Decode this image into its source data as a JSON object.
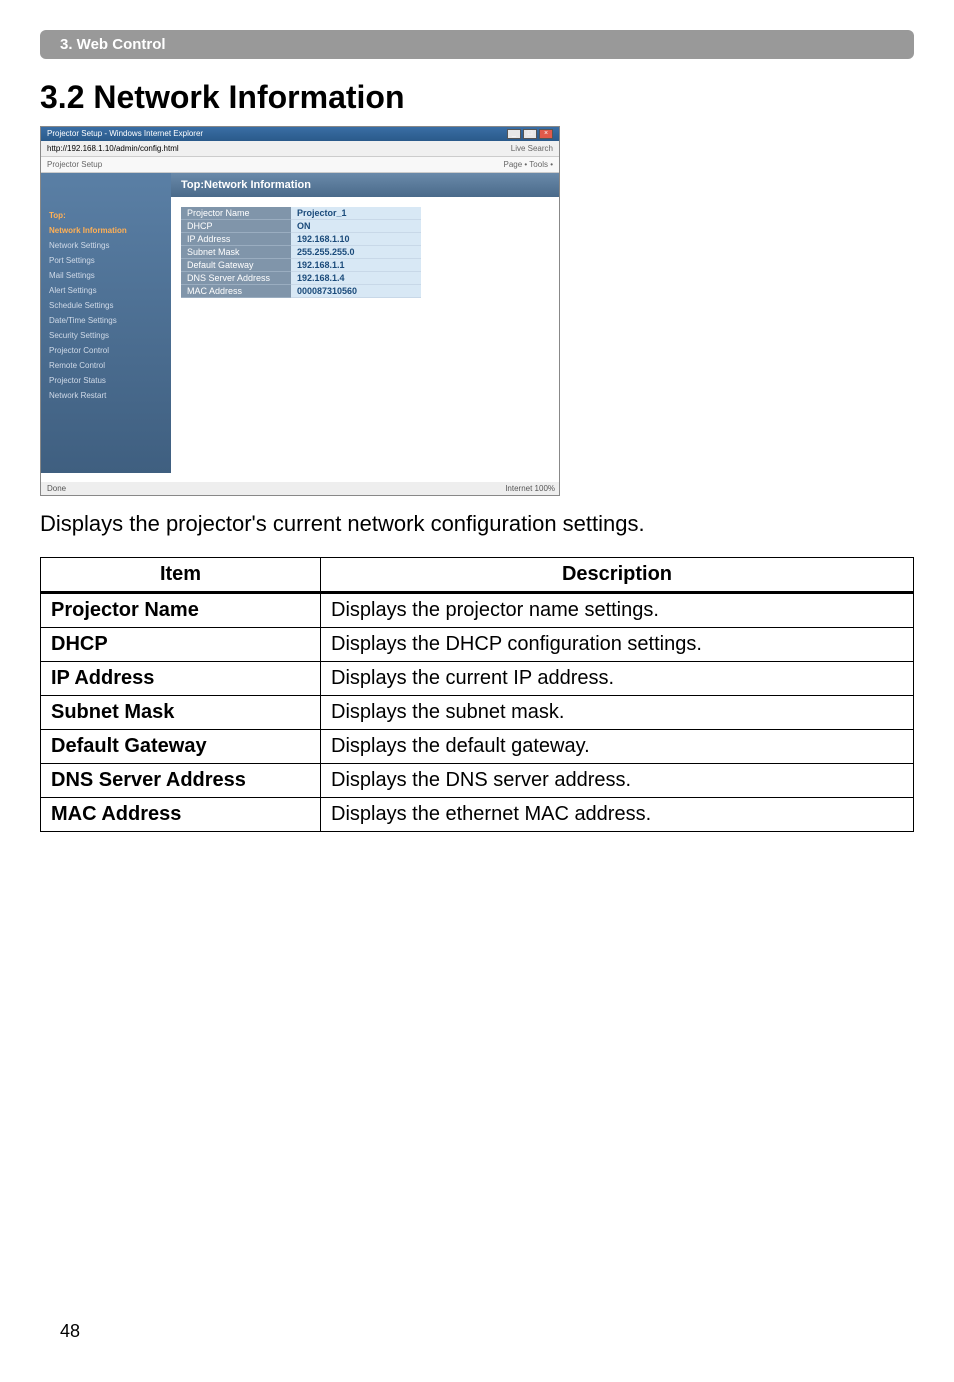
{
  "header_bar": "3. Web Control",
  "section_title": "3.2 Network Information",
  "screenshot": {
    "window_title": "Projector Setup - Windows Internet Explorer",
    "address": "http://192.168.1.10/admin/config.html",
    "tb_right": "Live Search",
    "tb2_left": "Projector Setup",
    "tb2_right": "Page • Tools •",
    "sidebar": {
      "top": "Top:",
      "items": [
        "Network Information",
        "Network Settings",
        "Port Settings",
        "Mail Settings",
        "Alert Settings",
        "Schedule Settings",
        "Date/Time Settings",
        "Security Settings",
        "Projector Control",
        "Remote Control",
        "Projector Status",
        "Network Restart"
      ]
    },
    "main_header": "Top:Network Information",
    "rows": [
      {
        "label": "Projector Name",
        "value": "Projector_1"
      },
      {
        "label": "DHCP",
        "value": "ON"
      },
      {
        "label": "IP Address",
        "value": "192.168.1.10"
      },
      {
        "label": "Subnet Mask",
        "value": "255.255.255.0"
      },
      {
        "label": "Default Gateway",
        "value": "192.168.1.1"
      },
      {
        "label": "DNS Server Address",
        "value": "192.168.1.4"
      },
      {
        "label": "MAC Address",
        "value": "000087310560"
      }
    ],
    "status_left": "Done",
    "status_right": "Internet    100%"
  },
  "description": "Displays the projector's current network configuration settings.",
  "table": {
    "headers": [
      "Item",
      "Description"
    ],
    "rows": [
      {
        "item": "Projector Name",
        "desc": "Displays the projector name settings."
      },
      {
        "item": "DHCP",
        "desc": "Displays the DHCP configuration settings."
      },
      {
        "item": "IP Address",
        "desc": "Displays the current IP address."
      },
      {
        "item": "Subnet Mask",
        "desc": "Displays the subnet mask."
      },
      {
        "item": "Default Gateway",
        "desc": "Displays the default gateway."
      },
      {
        "item": "DNS Server Address",
        "desc": "Displays the DNS server address."
      },
      {
        "item": "MAC Address",
        "desc": "Displays the ethernet MAC address."
      }
    ]
  },
  "page_number": "48"
}
